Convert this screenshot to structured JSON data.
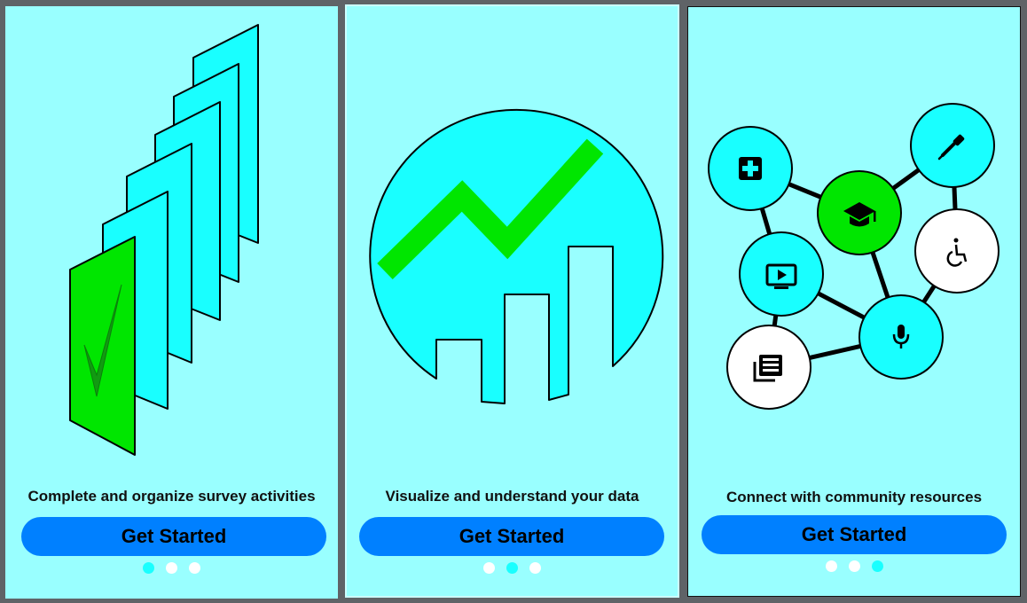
{
  "slides": [
    {
      "caption": "Complete and organize survey activities",
      "button_label": "Get Started",
      "active_dot": 1
    },
    {
      "caption": "Visualize and understand your data",
      "button_label": "Get Started",
      "active_dot": 2
    },
    {
      "caption": "Connect with community resources",
      "button_label": "Get Started",
      "active_dot": 3
    }
  ],
  "colors": {
    "background": "#99ffff",
    "accent_cyan": "#19ffff",
    "green": "#00e600",
    "button_blue": "#0080ff"
  },
  "network_icons": [
    "medical-cross-icon",
    "graduation-cap-icon",
    "eyedropper-icon",
    "tv-play-icon",
    "accessibility-icon",
    "microphone-icon",
    "news-icon"
  ]
}
